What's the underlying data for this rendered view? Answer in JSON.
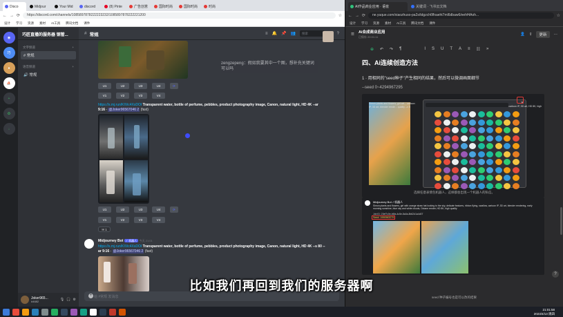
{
  "left_browser": {
    "tabs": [
      {
        "label": "Disco"
      },
      {
        "label": "Midjour"
      },
      {
        "label": "Your Mid"
      },
      {
        "label": "discord"
      },
      {
        "label": "(8) Pinte"
      },
      {
        "label": "广告创意"
      },
      {
        "label": "国际时尚"
      },
      {
        "label": "国际时尚"
      },
      {
        "label": "时尚"
      }
    ],
    "url": "https://discord.com/channels/1085897878222223232/1085897878222221200",
    "bookmarks": [
      "设计",
      "学习",
      "资源",
      "素材",
      "AI工具",
      "腾讯文档",
      "课件"
    ]
  },
  "discord": {
    "servers": [
      "",
      "",
      "服务器",
      "",
      "",
      ""
    ],
    "server_name": "巧匠直播的服务器 钢管...",
    "categories": [
      {
        "label": "文字频道",
        "channels": [
          {
            "name": "# 常规",
            "selected": true
          }
        ]
      },
      {
        "label": "语音频道",
        "channels": [
          {
            "name": "🔊 常规",
            "selected": false
          }
        ]
      }
    ],
    "channel_header": "常规",
    "search_placeholder": "搜索",
    "chat_bubble": "zengzepeng：假如我要其中一个图，想补充关键词可以吗",
    "upscale_rows": [
      {
        "u": [
          "U1",
          "U2",
          "U3",
          "U4"
        ],
        "refresh": "⟳"
      },
      {
        "v": [
          "V1",
          "V2",
          "V3",
          "V4"
        ]
      }
    ],
    "message1": {
      "link": "https://s.mj.run/KIVic4XsDOI",
      "prompt": "Transparent water, bottle of perfume, pebbles, product photography image, Canon, natural light, HD 4K --ar 9:16",
      "separator": "-",
      "mention": "@Joker96567046 2",
      "suffix": "(fast)"
    },
    "reaction": "✉ 1",
    "bot": {
      "name": "Midjourney Bot",
      "tag": "✓ 机器人",
      "time": "今天 21:01"
    },
    "message2": {
      "link": "https://s.mj.run/KIVic4XsDOI",
      "prompt": "Transparent water, bottle of perfume, pebbles, product photography image, Canon, natural light, HD 4K --s 80 --ar 9:16",
      "separator": "-",
      "mention": "@Joker96567046 2",
      "suffix": "(fast)"
    },
    "input_placeholder": "给 #常规 发消息",
    "user": {
      "name": "Joker965...",
      "tag": "#4682"
    }
  },
  "right_browser": {
    "tabs": [
      {
        "label": "AI作品商业应用 · 语雀"
      },
      {
        "label": "关键词 · 飞书云文档"
      }
    ],
    "url": "ne.yuque.com/xiaozhuso-pa2s/tdgzch6ffxaeht7ml6dbaw6/eehf4Aoh...",
    "bookmarks": [
      "设计",
      "学习",
      "资源",
      "素材",
      "AI工具",
      "腾讯文档",
      "课件"
    ],
    "doc_title": "Ai合成商业应用",
    "doc_meta": "已保存 20:01:11",
    "share_label": "更新",
    "heading": "四、Ai连续创造方法",
    "para1": "1 · 用相同的\"seed种子\"产生相同的结果，然后可以微调画面细节",
    "para2": "--seed 0~4294967295",
    "shot1_text": "Simon plants and flowers, girl wit...  cartoon IP, 3D art, blender rende... quality --v 5",
    "shot1_caption": "选择任意表情包机器人，这样都会出现一个机器人的私信。",
    "shot2_bot": "Midjourney Bot ✓机器人",
    "shot2_text": "Simon plants and flowers, girl with orange straw hat looking to the sky, delicate features, ribbon flying, swallow, cartoon IP, 3D art, blender rendering, early morning sunshine, blue sky and white clouds, Octane render, HD 8K, high quality",
    "shot2_job": "Job ID: 23ef7c0e-b6fa-4c5e-8a0a-8b62d1a4d07",
    "shot2_seed": "Seed: 1990963279",
    "bottom_caption": "seed 种子编号也是可以改的结果"
  },
  "subtitle": "比如我们再回到我们的服务器啊",
  "clock": {
    "time": "21:01:58",
    "date": "2023/4/13 周四"
  }
}
